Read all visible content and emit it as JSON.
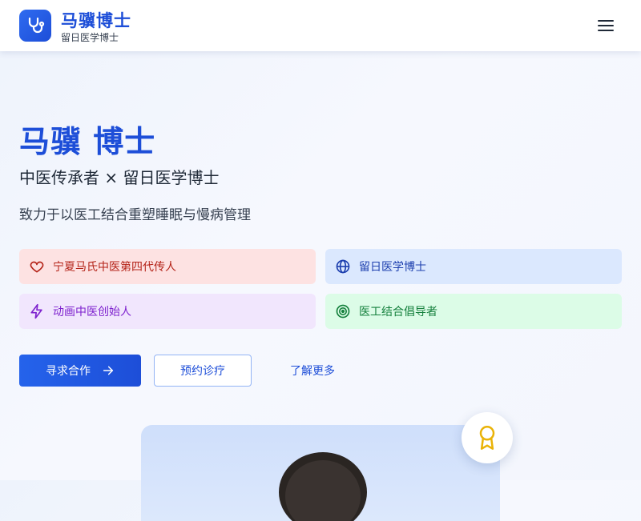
{
  "brand": {
    "title": "马骥博士",
    "subtitle": "留日医学博士",
    "logo_icon": "stethoscope-icon"
  },
  "header": {
    "menu_icon": "hamburger-menu-icon"
  },
  "hero": {
    "title": "马骥 博士",
    "subtitle": "中医传承者 × 留日医学博士",
    "tagline": "致力于以医工结合重塑睡眠与慢病管理"
  },
  "badges": [
    {
      "label": "宁夏马氏中医第四代传人",
      "icon": "heart-icon",
      "color": "#b42318"
    },
    {
      "label": "留日医学博士",
      "icon": "globe-icon",
      "color": "#1e40af"
    },
    {
      "label": "动画中医创始人",
      "icon": "lightning-icon",
      "color": "#7e22ce"
    },
    {
      "label": "医工结合倡导者",
      "icon": "target-icon",
      "color": "#15803d"
    }
  ],
  "actions": {
    "primary": "寻求合作",
    "secondary": "预约诊疗",
    "link": "了解更多"
  },
  "colors": {
    "accent": "#1d4ed8",
    "award": "#eab308"
  }
}
